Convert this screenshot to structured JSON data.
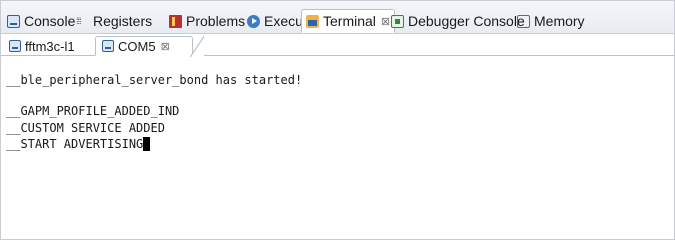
{
  "view_tabs": [
    {
      "label": "Console",
      "icon": "console-icon"
    },
    {
      "label": "Registers",
      "icon": "registers-icon"
    },
    {
      "label": "Problems",
      "icon": "problems-icon"
    },
    {
      "label": "Executables",
      "icon": "executables-icon"
    },
    {
      "label": "Terminal",
      "icon": "terminal-icon",
      "active": true,
      "close": "⊠"
    },
    {
      "label": "Debugger Console",
      "icon": "debugger-console-icon"
    },
    {
      "label": "Memory",
      "icon": "memory-icon"
    }
  ],
  "session_tabs": [
    {
      "label": "fftm3c-l1",
      "icon": "monitor-icon"
    },
    {
      "label": "COM5",
      "icon": "monitor-icon",
      "active": true,
      "close": "⊠"
    }
  ],
  "terminal": {
    "lines": [
      "__ble_peripheral_server_bond has started!",
      "",
      "__GAPM_PROFILE_ADDED_IND",
      "__CUSTOM SERVICE ADDED",
      "__START ADVERTISING"
    ]
  },
  "colors": {
    "accent": "#2f5f9a",
    "tab_border": "#b9c1cc",
    "background": "#ffffff"
  }
}
